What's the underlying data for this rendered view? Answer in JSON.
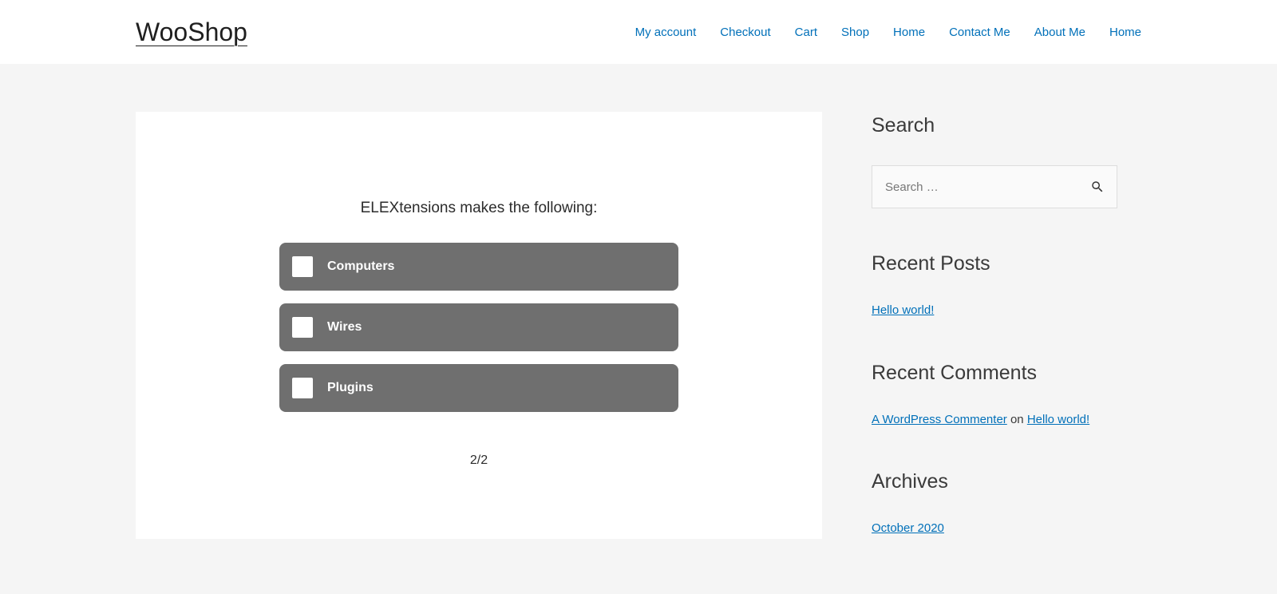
{
  "header": {
    "site_title": "WooShop",
    "nav": [
      "My account",
      "Checkout",
      "Cart",
      "Shop",
      "Home",
      "Contact Me",
      "About Me",
      "Home"
    ]
  },
  "quiz": {
    "question": "ELEXtensions makes the following:",
    "answers": [
      "Computers",
      "Wires",
      "Plugins"
    ],
    "counter": "2/2"
  },
  "sidebar": {
    "search": {
      "title": "Search",
      "placeholder": "Search …"
    },
    "recent_posts": {
      "title": "Recent Posts",
      "items": [
        "Hello world!"
      ]
    },
    "recent_comments": {
      "title": "Recent Comments",
      "items": [
        {
          "author": "A WordPress Commenter",
          "sep": " on ",
          "post": "Hello world!"
        }
      ]
    },
    "archives": {
      "title": "Archives",
      "items": [
        "October 2020"
      ]
    }
  }
}
